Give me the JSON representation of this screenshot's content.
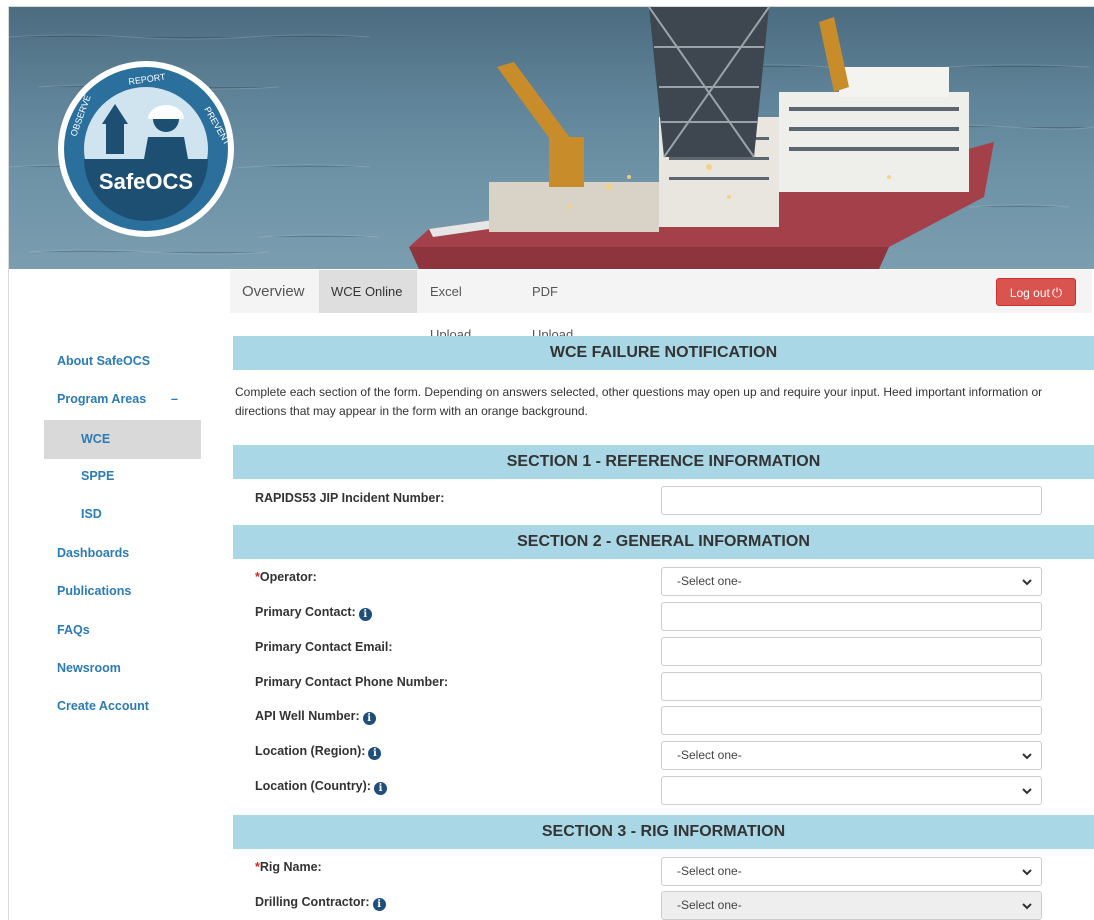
{
  "logo": {
    "brand": "SafeOCS",
    "ring_words": [
      "REPORT",
      "OBSERVE",
      "PREVENT"
    ]
  },
  "tabs": [
    {
      "label": "Overview",
      "active": false
    },
    {
      "label": "WCE Online",
      "active": true
    },
    {
      "label": "Excel Upload",
      "active": false
    },
    {
      "label": "PDF Upload",
      "active": false
    }
  ],
  "logout": {
    "label": "Log out",
    "icon": "power-icon",
    "color": "#d9534f"
  },
  "sidebar": {
    "items": [
      {
        "label": "About SafeOCS"
      },
      {
        "label": "Program Areas",
        "toggle": "–"
      },
      {
        "label": "WCE",
        "active": true
      },
      {
        "label": "SPPE"
      },
      {
        "label": "ISD"
      },
      {
        "label": "Dashboards"
      },
      {
        "label": "Publications"
      },
      {
        "label": "FAQs"
      },
      {
        "label": "Newsroom"
      },
      {
        "label": "Create Account"
      }
    ]
  },
  "main": {
    "title": "WCE FAILURE NOTIFICATION",
    "intro": "Complete each section of the form. Depending on answers selected, other questions may open up and require your input. Heed important information or directions that may appear in the form with an orange background.",
    "sections": [
      {
        "title": "SECTION 1 - REFERENCE INFORMATION"
      },
      {
        "title": "SECTION 2 - GENERAL INFORMATION"
      },
      {
        "title": "SECTION 3 - RIG INFORMATION"
      }
    ],
    "fields": {
      "rapids": {
        "label": "RAPIDS53 JIP Incident Number:",
        "value": ""
      },
      "operator": {
        "required": "*",
        "label": "Operator:",
        "value": "-Select one-"
      },
      "primary_contact": {
        "label": "Primary Contact:",
        "value": ""
      },
      "primary_email": {
        "label": "Primary Contact Email:",
        "value": ""
      },
      "primary_phone": {
        "label": "Primary Contact Phone Number:",
        "value": ""
      },
      "api_well": {
        "label": "API Well Number:",
        "value": ""
      },
      "region": {
        "label": "Location (Region):",
        "value": "-Select one-"
      },
      "country": {
        "label": "Location (Country):",
        "value": ""
      },
      "rig_name": {
        "required": "*",
        "label": "Rig Name:",
        "value": "-Select one-"
      },
      "drilling_contractor": {
        "label": "Drilling Contractor:",
        "value": "-Select one-"
      }
    }
  },
  "colors": {
    "section_bar": "#a9d7e6",
    "link": "#2b7bb5",
    "required": "#d9261c",
    "info_icon": "#1f4e79"
  }
}
